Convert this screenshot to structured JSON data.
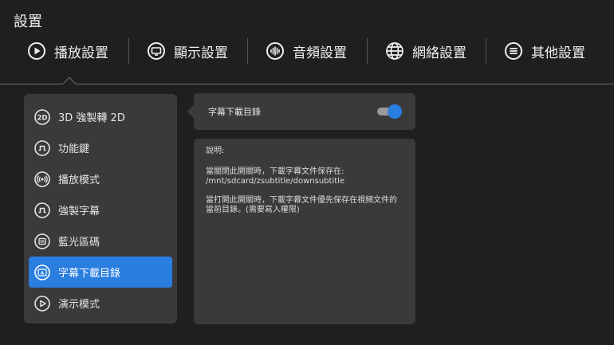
{
  "page": {
    "title": "設置"
  },
  "tabs": [
    {
      "label": "播放設置",
      "icon": "play-circle-icon"
    },
    {
      "label": "顯示設置",
      "icon": "display-icon"
    },
    {
      "label": "音頻設置",
      "icon": "audio-wave-icon"
    },
    {
      "label": "網絡設置",
      "icon": "globe-icon"
    },
    {
      "label": "其他設置",
      "icon": "menu-circle-icon"
    }
  ],
  "menu": {
    "items": [
      {
        "label": "3D 強製轉 2D",
        "icon": "2d-icon"
      },
      {
        "label": "功能鍵",
        "icon": "pulse-icon"
      },
      {
        "label": "播放模式",
        "icon": "broadcast-icon"
      },
      {
        "label": "強製字幕",
        "icon": "pulse-icon"
      },
      {
        "label": "藍光區碼",
        "icon": "disc-code-icon"
      },
      {
        "label": "字幕下載目錄",
        "icon": "subtitle-icon"
      },
      {
        "label": "演示模式",
        "icon": "play-circle-icon"
      }
    ],
    "active_index": 5
  },
  "setting": {
    "label": "字幕下載目錄",
    "enabled": true
  },
  "description": {
    "title": "說明:",
    "lines": [
      "當關閉此開關時，下載字幕文件保存在: /mnt/sdcard/zsubtitle/downsubtitle",
      "當打開此開關時，下載字幕文件優先保存在視頻文件的當前目錄。(需要寫入權限)"
    ]
  },
  "colors": {
    "accent": "#2a7ee0",
    "panel": "#3a3a3a",
    "background": "#1f1f1f"
  }
}
